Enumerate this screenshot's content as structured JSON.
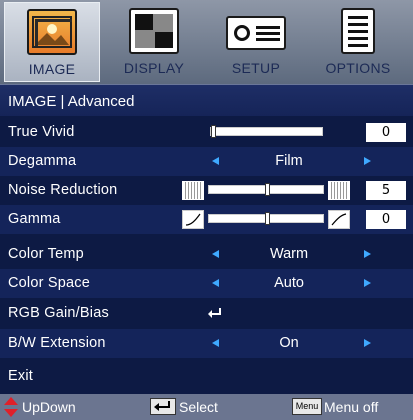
{
  "tabs": [
    {
      "label": "IMAGE",
      "icon": "image-icon",
      "active": true
    },
    {
      "label": "DISPLAY",
      "icon": "display-icon",
      "active": false
    },
    {
      "label": "SETUP",
      "icon": "projector-icon",
      "active": false
    },
    {
      "label": "OPTIONS",
      "icon": "options-icon",
      "active": false
    }
  ],
  "header": {
    "title": "IMAGE | Advanced"
  },
  "rows": {
    "true_vivid": {
      "label": "True Vivid",
      "value": "0",
      "level": 0
    },
    "degamma": {
      "label": "Degamma",
      "value": "Film"
    },
    "noise_reduction": {
      "label": "Noise Reduction",
      "value": "5",
      "level": 0.5
    },
    "gamma": {
      "label": "Gamma",
      "value": "0",
      "level": 0.5
    },
    "color_temp": {
      "label": "Color Temp",
      "value": "Warm"
    },
    "color_space": {
      "label": "Color Space",
      "value": "Auto"
    },
    "rgb_gain": {
      "label": "RGB Gain/Bias"
    },
    "bw_extension": {
      "label": "B/W Extension",
      "value": "On"
    },
    "exit": {
      "label": "Exit"
    }
  },
  "footer": {
    "updown": "UpDown",
    "select": "Select",
    "menu_key": "Menu",
    "menu_off": "Menu off"
  },
  "colors": {
    "accent": "#3fa9ff",
    "background": "#0d1a44",
    "arrow_red": "#e0202a"
  }
}
